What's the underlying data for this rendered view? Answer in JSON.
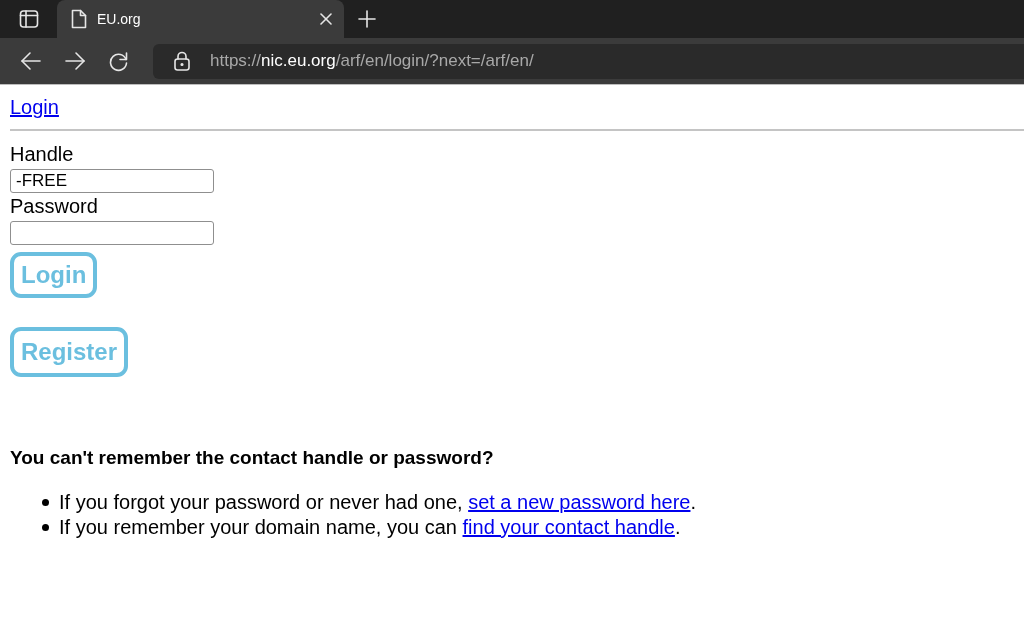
{
  "browser": {
    "tab": {
      "title": "EU.org"
    },
    "address": {
      "scheme": "https://",
      "host": "nic.eu.org",
      "path": "/arf/en/login/?next=/arf/en/"
    }
  },
  "page": {
    "nav_link": "Login",
    "form": {
      "fields": [
        {
          "label": "Handle",
          "value": "-FREE"
        },
        {
          "label": "Password"
        }
      ],
      "buttons": [
        "Login",
        "Register"
      ]
    },
    "help": {
      "heading": "You can't remember the contact handle or password?",
      "items": [
        {
          "text": "If you forgot your password or never had one, ",
          "link": "set a new password here",
          "after": "."
        },
        {
          "text": "If you remember your domain name, you can ",
          "link": "find your contact handle",
          "after": "."
        }
      ]
    }
  }
}
